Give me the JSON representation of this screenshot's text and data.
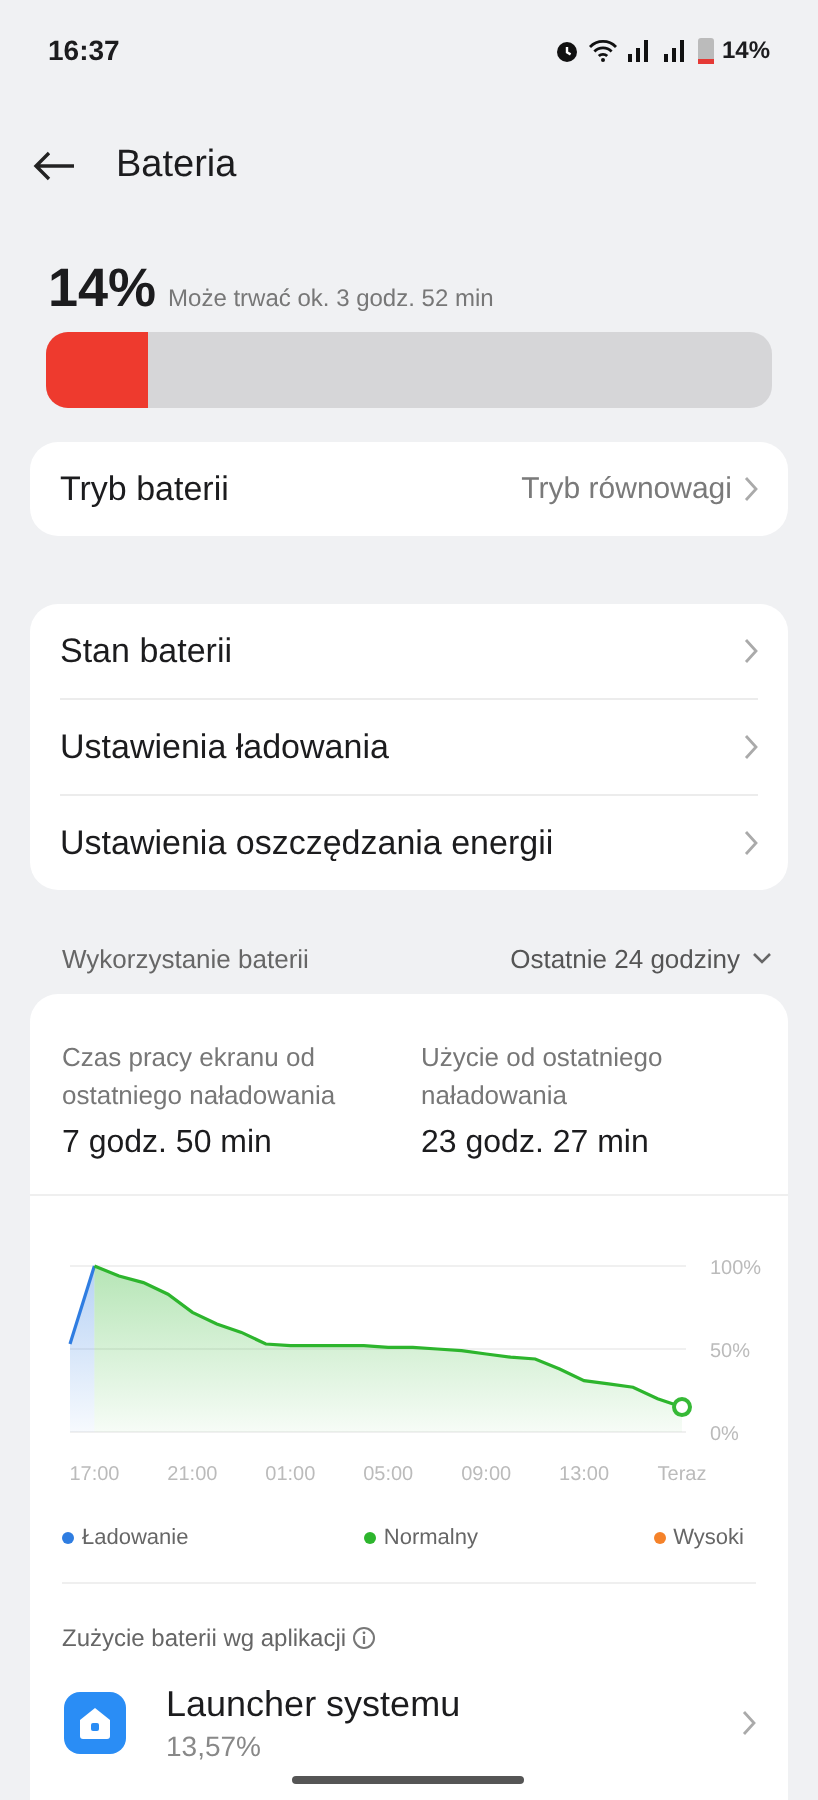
{
  "status_bar": {
    "time": "16:37",
    "battery": "14%"
  },
  "header": {
    "title": "Bateria"
  },
  "battery": {
    "percent": "14%",
    "estimate": "Może trwać ok. 3 godz. 52 min",
    "level": 0.14
  },
  "mode_row": {
    "label": "Tryb baterii",
    "value": "Tryb równowagi"
  },
  "settings": [
    {
      "label": "Stan baterii"
    },
    {
      "label": "Ustawienia ładowania"
    },
    {
      "label": "Ustawienia oszczędzania energii"
    }
  ],
  "usage": {
    "title": "Wykorzystanie baterii",
    "period": "Ostatnie 24 godziny",
    "stats": [
      {
        "label": "Czas pracy ekranu od ostatniego naładowania",
        "value": "7 godz. 50 min"
      },
      {
        "label": "Użycie od ostatniego naładowania",
        "value": "23 godz. 27 min"
      }
    ],
    "chart_data": {
      "type": "area",
      "categories": [
        null,
        "17:00",
        null,
        null,
        null,
        "21:00",
        null,
        null,
        null,
        "01:00",
        null,
        null,
        null,
        "05:00",
        null,
        null,
        null,
        "09:00",
        null,
        null,
        null,
        "13:00",
        null,
        null,
        null,
        "Teraz"
      ],
      "series": [
        {
          "name": "Ładowanie",
          "color": "#2f7de1",
          "values": [
            53,
            100,
            null,
            null,
            null,
            null,
            null,
            null,
            null,
            null,
            null,
            null,
            null,
            null,
            null,
            null,
            null,
            null,
            null,
            null,
            null,
            null,
            null,
            null,
            null,
            null
          ]
        },
        {
          "name": "Normalny",
          "color": "#2db52d",
          "values": [
            null,
            100,
            94,
            90,
            83,
            72,
            65,
            60,
            53,
            52,
            52,
            52,
            52,
            51,
            51,
            50,
            49,
            47,
            45,
            44,
            38,
            31,
            29,
            27,
            20,
            15
          ]
        },
        {
          "name": "Wysoki",
          "color": "#f5822a",
          "values": [
            null,
            null,
            null,
            null,
            null,
            null,
            null,
            null,
            null,
            null,
            null,
            null,
            null,
            null,
            null,
            null,
            null,
            null,
            null,
            null,
            null,
            null,
            null,
            null,
            null,
            null
          ]
        }
      ],
      "ylim": [
        0,
        100
      ],
      "yticks": [
        {
          "value": 0,
          "label": "0%"
        },
        {
          "value": 50,
          "label": "50%"
        },
        {
          "value": 100,
          "label": "100%"
        }
      ]
    }
  },
  "apps": {
    "title": "Zużycie baterii wg aplikacji",
    "items": [
      {
        "name": "Launcher systemu",
        "share": "13,57%"
      }
    ]
  }
}
